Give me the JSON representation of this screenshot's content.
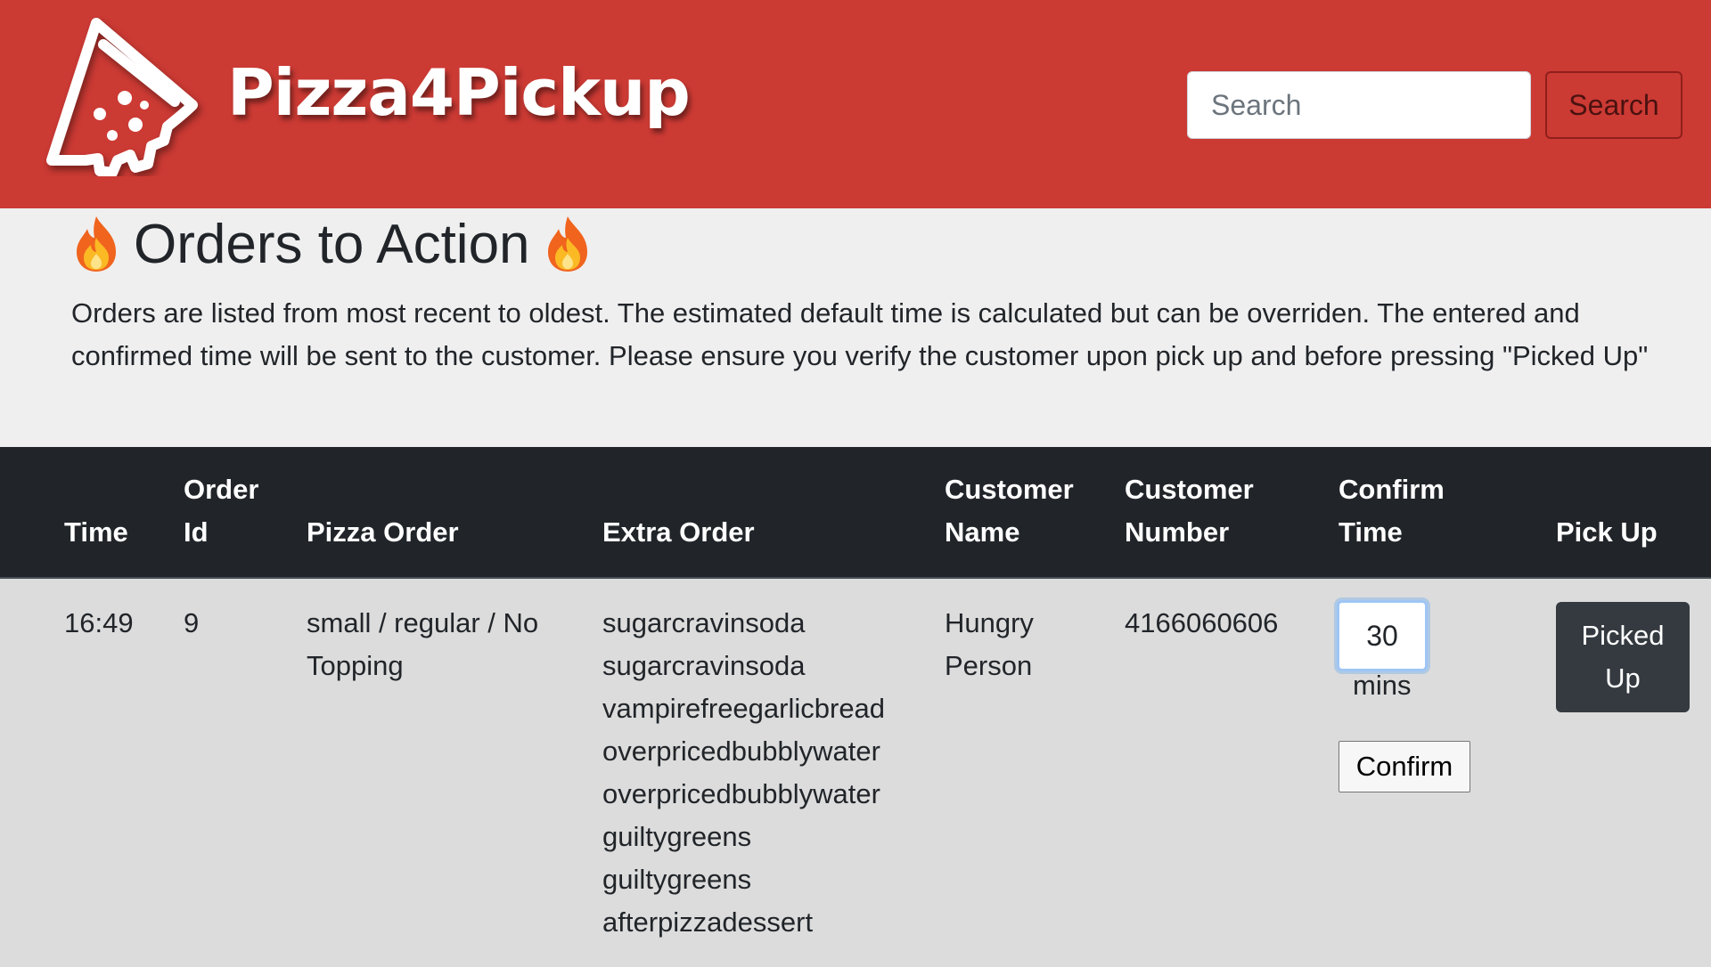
{
  "header": {
    "brand": "Pizza4Pickup",
    "logo_icon": "pizza-slice-icon",
    "brand_color": "#cc3a34",
    "search": {
      "placeholder": "Search",
      "value": "",
      "button_label": "Search"
    }
  },
  "page": {
    "title": "Orders to Action",
    "title_icon": "fire-icon",
    "intro": "Orders are listed from most recent to oldest. The estimated default time is calculated but can be overriden. The entered and confirmed time will be sent to the customer. Please ensure you verify the customer upon pick up and before pressing \"Picked Up\""
  },
  "orders_table": {
    "columns": {
      "time": "Time",
      "order_id": "Order Id",
      "pizza_order": "Pizza Order",
      "extra_order": "Extra Order",
      "customer_name": "Customer Name",
      "customer_number": "Customer Number",
      "confirm_time": "Confirm Time",
      "pick_up": "Pick Up"
    },
    "rows": [
      {
        "time": "16:49",
        "order_id": "9",
        "pizza_order": "small / regular / No Topping",
        "extra_order": [
          "sugarcravinsoda",
          "sugarcravinsoda",
          "vampirefreegarlicbread",
          "overpricedbubblywater",
          "overpricedbubblywater",
          "guiltygreens",
          "guiltygreens",
          "afterpizzadessert"
        ],
        "customer_name": "Hungry Person",
        "customer_number": "4166060606",
        "confirm_time_value": "30",
        "mins_label": "mins",
        "confirm_label": "Confirm",
        "pick_up_label": "Picked Up"
      }
    ]
  }
}
